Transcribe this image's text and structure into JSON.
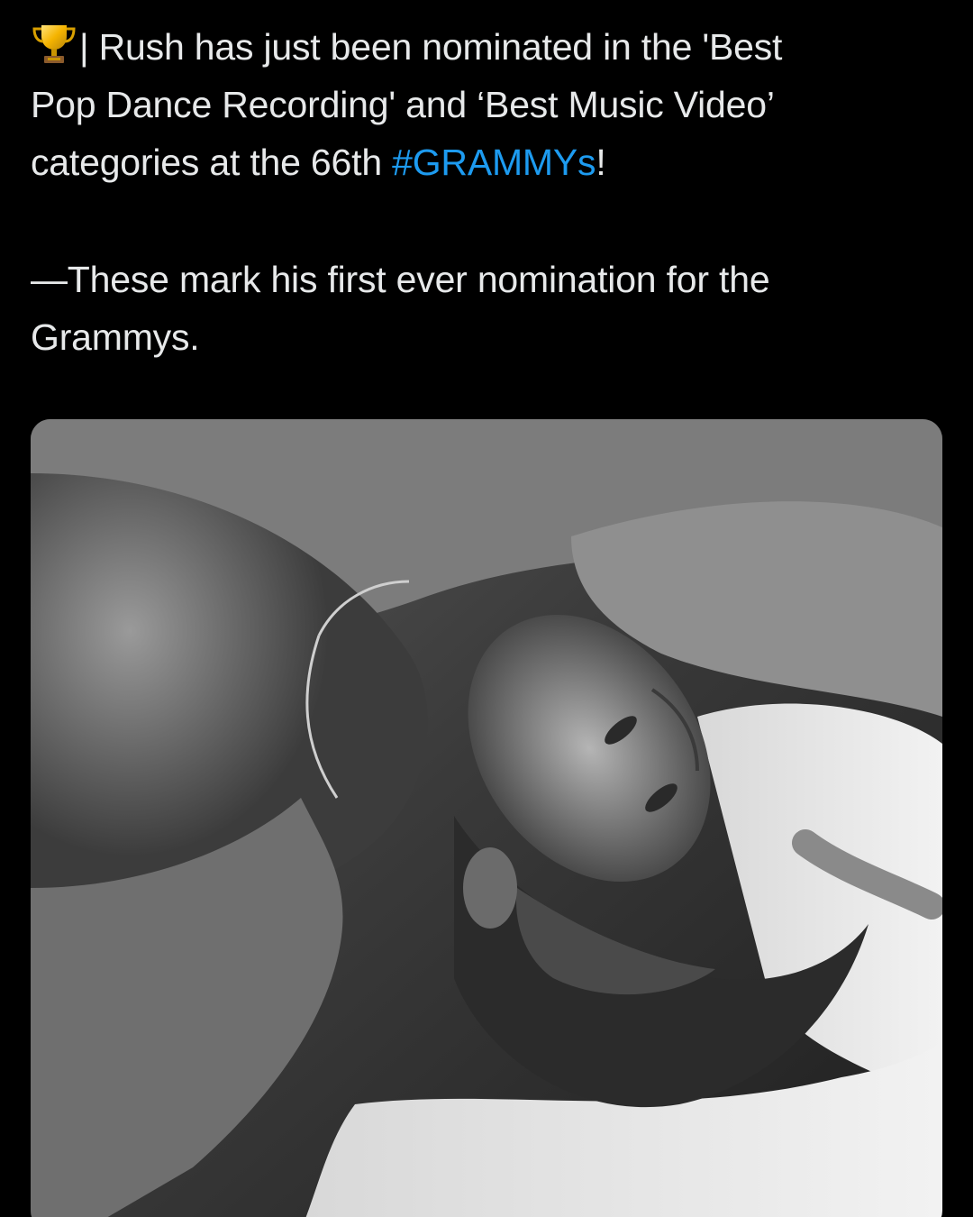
{
  "colors": {
    "background": "#000000",
    "text": "#e7e9ea",
    "link": "#1d9bf0"
  },
  "tweet": {
    "icon": "trophy-icon",
    "line1": "| Rush has just been nominated in the 'Best",
    "line2": "Pop Dance Recording' and ‘Best Music Video’",
    "line3_before": "categories at the 66th ",
    "hashtag": "#GRAMMYs",
    "line3_after": "!",
    "line4": "—These mark his first ever nomination for the",
    "line5": "Grammys."
  },
  "media": {
    "icon": "photo-icon"
  }
}
